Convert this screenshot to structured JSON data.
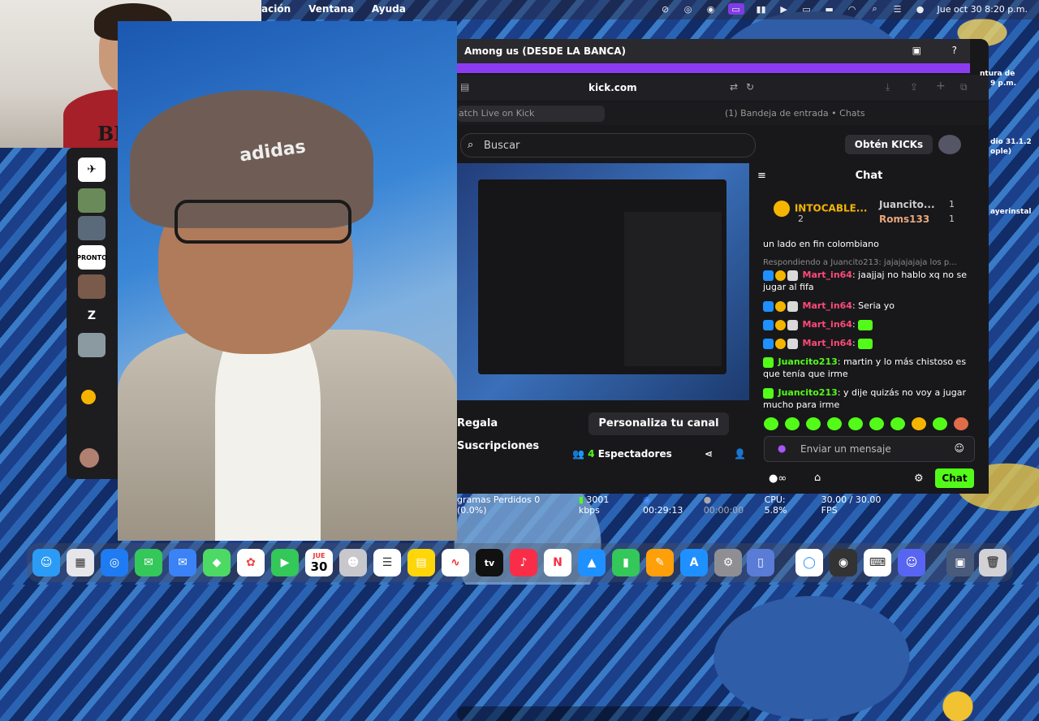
{
  "menubar": {
    "items": [
      "ación",
      "Ventana",
      "Ayuda"
    ],
    "datetime": "Jue oct 30  8:20 p.m."
  },
  "camera_small": {
    "shirt_text": "BENCH"
  },
  "camera_big": {
    "beanie_text": "adidas"
  },
  "sidebar": {
    "letter": "Z",
    "pronto": "PRONTO"
  },
  "window": {
    "title": "Among us (DESDE LA BANCA)",
    "url": "kick.com"
  },
  "tabs": {
    "tab1": "atch Live on Kick",
    "tab2": "(1) Bandeja de entrada • Chats"
  },
  "search": {
    "placeholder": "Buscar"
  },
  "header": {
    "kicks_button": "Obtén KICKs"
  },
  "stream_controls": {
    "gift": "Regala Suscripciones",
    "customize": "Personaliza tu canal",
    "viewers_count": "4",
    "viewers_label": "Espectadores"
  },
  "chat": {
    "title": "Chat",
    "leaderboard": {
      "first_name": "INTOCABLE...",
      "first_count": "2",
      "second_name": "Juancito...",
      "second_count": "1",
      "third_name": "Roms133",
      "third_count": "1"
    },
    "partial": "un lado en fin colombiano",
    "reply_to": "Respondiendo a Juancito213: jajajajajaja los p...",
    "messages": [
      {
        "user": "Mart_in64",
        "text": ": jaajjaj no hablo xq no se jugar al fifa",
        "color": "#ff4a77"
      },
      {
        "user": "Mart_in64",
        "text": ": Seria yo",
        "color": "#ff4a77"
      },
      {
        "user": "Mart_in64",
        "text": ":",
        "color": "#ff4a77"
      },
      {
        "user": "Mart_in64",
        "text": ":",
        "color": "#ff4a77"
      },
      {
        "user": "Juancito213",
        "text": ": martin y lo más chistoso es que tenía que irme",
        "color": "#53fc18"
      },
      {
        "user": "Juancito213",
        "text": ": y dije quizás no voy a jugar mucho para irme",
        "color": "#53fc18"
      }
    ],
    "input_placeholder": "Enviar un mensaje",
    "send_button": "Chat"
  },
  "obs_stats": {
    "dropped": "gramas Perdidos 0 (0.0%)",
    "bitrate": "3001 kbps",
    "live_time": "00:29:13",
    "rec_time": "00:00:00",
    "cpu": "CPU: 5.8%",
    "fps": "30.00 / 30.00 FPS"
  },
  "dock": {
    "calendar_month": "JUE",
    "calendar_day": "30",
    "tv_label": "tv"
  },
  "desktop": {
    "label1": "ntura de",
    "label2": "9 p.m.",
    "label3": "dio 31.1.2",
    "label4": "ople)",
    "label5": "ayerinstal"
  }
}
